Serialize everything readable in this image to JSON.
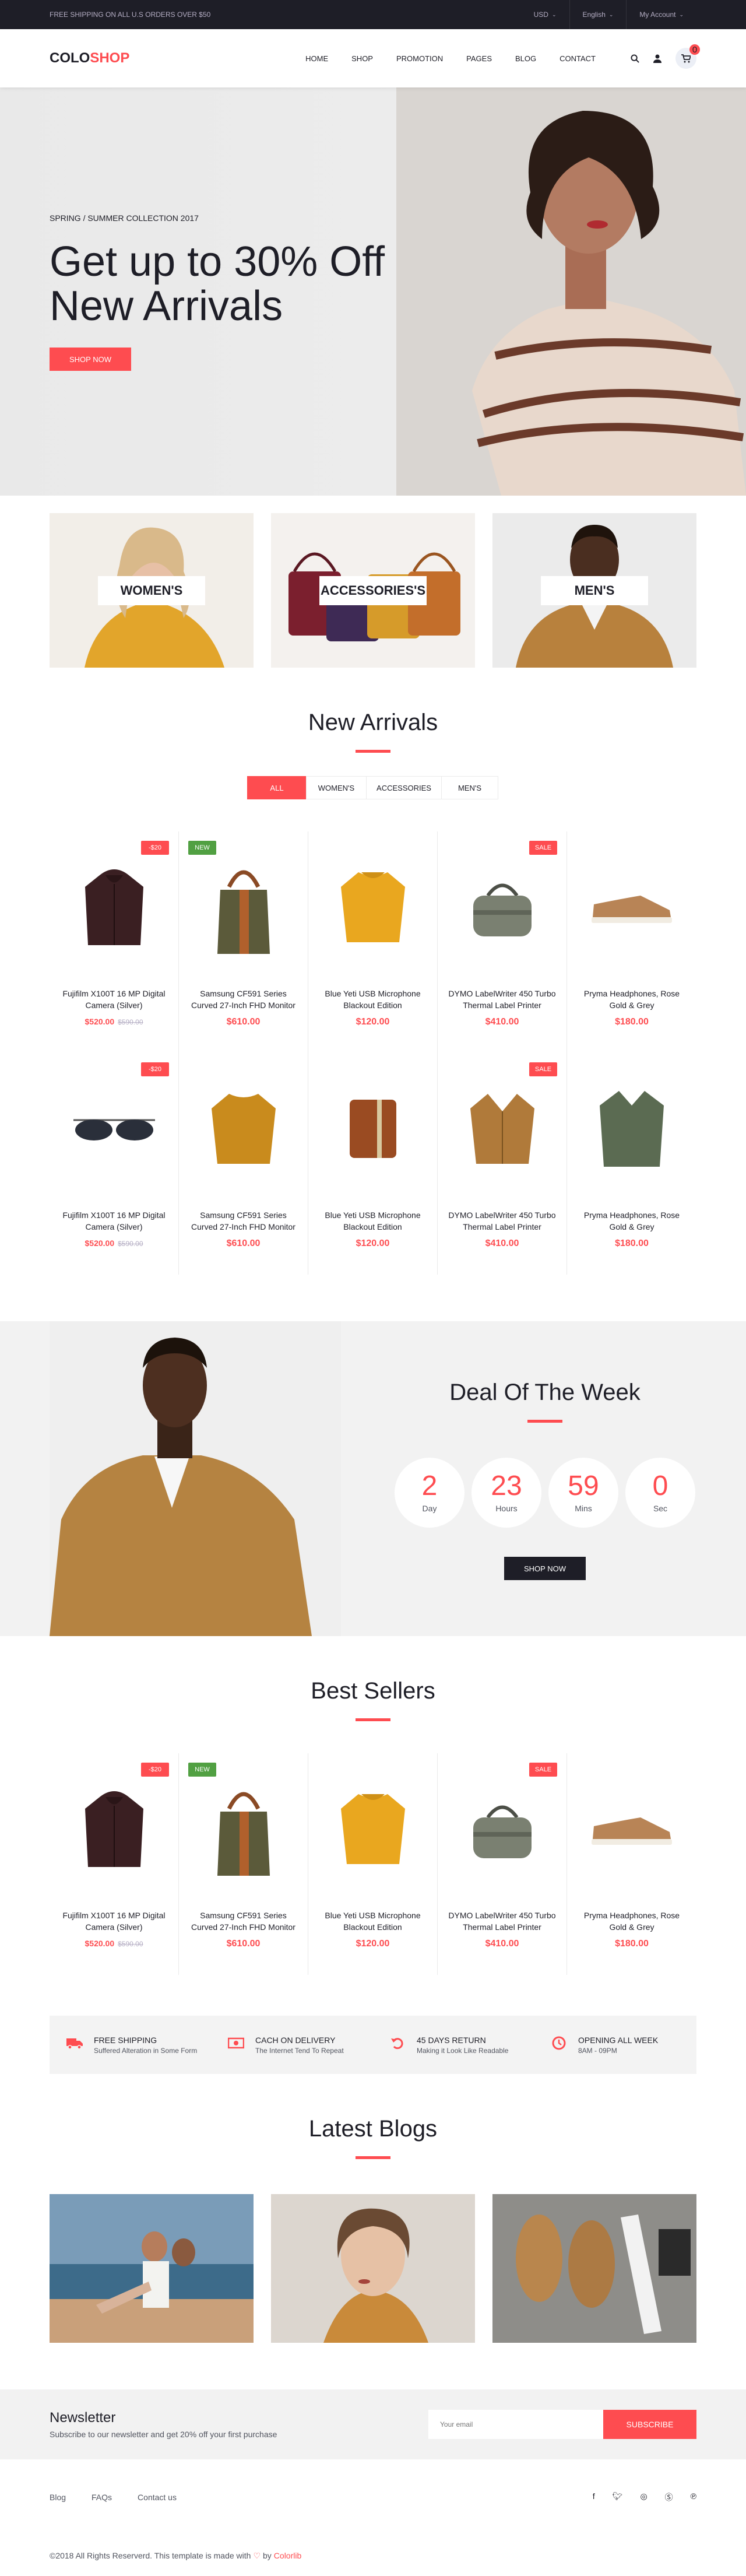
{
  "topbar": {
    "shipping": "FREE SHIPPING ON ALL U.S ORDERS OVER $50",
    "currency": "USD",
    "language": "English",
    "account": "My Account"
  },
  "header": {
    "logo_part1": "COLO",
    "logo_part2": "SHOP",
    "nav": [
      "HOME",
      "SHOP",
      "PROMOTION",
      "PAGES",
      "BLOG",
      "CONTACT"
    ],
    "cart_count": "0"
  },
  "hero": {
    "subtitle": "SPRING / SUMMER COLLECTION 2017",
    "title_line1": "Get up to 30% Off",
    "title_line2": "New Arrivals",
    "button": "SHOP NOW"
  },
  "banners": [
    "WOMEN'S",
    "ACCESSORIES'S",
    "MEN'S"
  ],
  "new_arrivals": {
    "title": "New Arrivals",
    "tabs": [
      "ALL",
      "WOMEN'S",
      "ACCESSORIES",
      "MEN'S"
    ],
    "row1": [
      {
        "name": "Fujifilm X100T 16 MP Digital Camera (Silver)",
        "price": "$520.00",
        "old": "$590.00",
        "badge": "-$20"
      },
      {
        "name": "Samsung CF591 Series Curved 27-Inch FHD Monitor",
        "price": "$610.00",
        "badge": "NEW"
      },
      {
        "name": "Blue Yeti USB Microphone Blackout Edition",
        "price": "$120.00"
      },
      {
        "name": "DYMO LabelWriter 450 Turbo Thermal Label Printer",
        "price": "$410.00",
        "badge": "SALE"
      },
      {
        "name": "Pryma Headphones, Rose Gold & Grey",
        "price": "$180.00"
      }
    ],
    "row2": [
      {
        "name": "Fujifilm X100T 16 MP Digital Camera (Silver)",
        "price": "$520.00",
        "old": "$590.00",
        "badge": "-$20"
      },
      {
        "name": "Samsung CF591 Series Curved 27-Inch FHD Monitor",
        "price": "$610.00"
      },
      {
        "name": "Blue Yeti USB Microphone Blackout Edition",
        "price": "$120.00"
      },
      {
        "name": "DYMO LabelWriter 450 Turbo Thermal Label Printer",
        "price": "$410.00",
        "badge": "SALE"
      },
      {
        "name": "Pryma Headphones, Rose Gold & Grey",
        "price": "$180.00"
      }
    ]
  },
  "deal": {
    "title": "Deal Of The Week",
    "days": "2",
    "days_label": "Day",
    "hours": "23",
    "hours_label": "Hours",
    "mins": "59",
    "mins_label": "Mins",
    "secs": "0",
    "secs_label": "Sec",
    "button": "SHOP NOW"
  },
  "best_sellers": {
    "title": "Best Sellers",
    "items": [
      {
        "name": "Fujifilm X100T 16 MP Digital Camera (Silver)",
        "price": "$520.00",
        "old": "$590.00",
        "badge": "-$20"
      },
      {
        "name": "Samsung CF591 Series Curved 27-Inch FHD Monitor",
        "price": "$610.00",
        "badge": "NEW"
      },
      {
        "name": "Blue Yeti USB Microphone Blackout Edition",
        "price": "$120.00"
      },
      {
        "name": "DYMO LabelWriter 450 Turbo Thermal Label Printer",
        "price": "$410.00",
        "badge": "SALE"
      },
      {
        "name": "Pryma Headphones, Rose Gold & Grey",
        "price": "$180.00"
      }
    ]
  },
  "benefits": [
    {
      "title": "FREE SHIPPING",
      "text": "Suffered Alteration in Some Form",
      "icon": "truck-icon"
    },
    {
      "title": "CACH ON DELIVERY",
      "text": "The Internet Tend To Repeat",
      "icon": "money-icon"
    },
    {
      "title": "45 DAYS RETURN",
      "text": "Making it Look Like Readable",
      "icon": "undo-icon"
    },
    {
      "title": "OPENING ALL WEEK",
      "text": "8AM - 09PM",
      "icon": "clock-icon"
    }
  ],
  "blogs": {
    "title": "Latest Blogs"
  },
  "newsletter": {
    "title": "Newsletter",
    "text": "Subscribe to our newsletter and get 20% off your first purchase",
    "placeholder": "Your email",
    "button": "SUBSCRIBE"
  },
  "footer": {
    "links": [
      "Blog",
      "FAQs",
      "Contact us"
    ],
    "copyright": "©2018 All Rights Reserverd. This template is made with",
    "by": "by",
    "credit": "Colorlib"
  },
  "colors": {
    "accent": "#fe4c50",
    "dark": "#1e1e27",
    "new_badge": "#51a042"
  }
}
